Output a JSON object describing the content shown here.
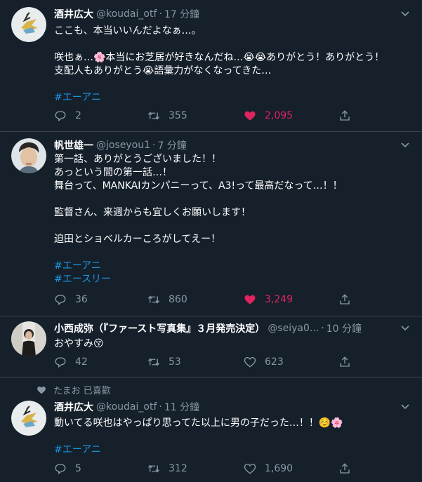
{
  "tweets": [
    {
      "author_name": "酒井広大",
      "handle": "@koudai_otf",
      "separator": "·",
      "time": "17 分鐘",
      "lines": [
        "ここも、本当いいんだよなぁ…。",
        "",
        "咲也ぁ…🌸本当にお芝居が好きなんだね…😭😭ありがとう！ありがとう！",
        "支配人もありがとう😭語彙力がなくなってきた…",
        "",
        "#エーアニ"
      ],
      "reply_count": "2",
      "retweet_count": "355",
      "like_count": "2,095",
      "liked": true
    },
    {
      "author_name": "帆世雄一",
      "handle": "@joseyou1",
      "separator": "·",
      "time": "7 分鐘",
      "lines": [
        "第一話、ありがとうございました！！",
        "あっという間の第一話…！",
        "舞台って、MANKAIカンパニーって、A3!って最高だなって…！！",
        "",
        "監督さん、来週からも宜しくお願いします！",
        "",
        "迫田とショベルカーころがしてえー！",
        "",
        "#エーアニ",
        "#エースリー"
      ],
      "reply_count": "36",
      "retweet_count": "860",
      "like_count": "3,249",
      "liked": true
    },
    {
      "author_name": "小西成弥（『ファースト写真集』３月発売決定）",
      "handle": "@seiya0...",
      "separator": "·",
      "time": "10 分鐘",
      "lines": [
        "おやすみ😚"
      ],
      "reply_count": "42",
      "retweet_count": "53",
      "like_count": "623",
      "liked": false
    },
    {
      "social_context": "たまお 已喜歡",
      "author_name": "酒井広大",
      "handle": "@koudai_otf",
      "separator": "·",
      "time": "11 分鐘",
      "lines": [
        "動いてる咲也はやっぱり思ってた以上に男の子だった…！！☺️🌸",
        "",
        "#エーアニ"
      ],
      "reply_count": "5",
      "retweet_count": "312",
      "like_count": "1,690",
      "liked": false
    }
  ],
  "colors": {
    "background": "#15202b",
    "border": "#38444d",
    "secondary_text": "#8899a6",
    "link": "#1b95e0",
    "like": "#e0245e"
  },
  "icons": [
    "reply-icon",
    "retweet-icon",
    "like-icon",
    "share-icon",
    "chevron-down-icon",
    "heart-small-icon"
  ]
}
